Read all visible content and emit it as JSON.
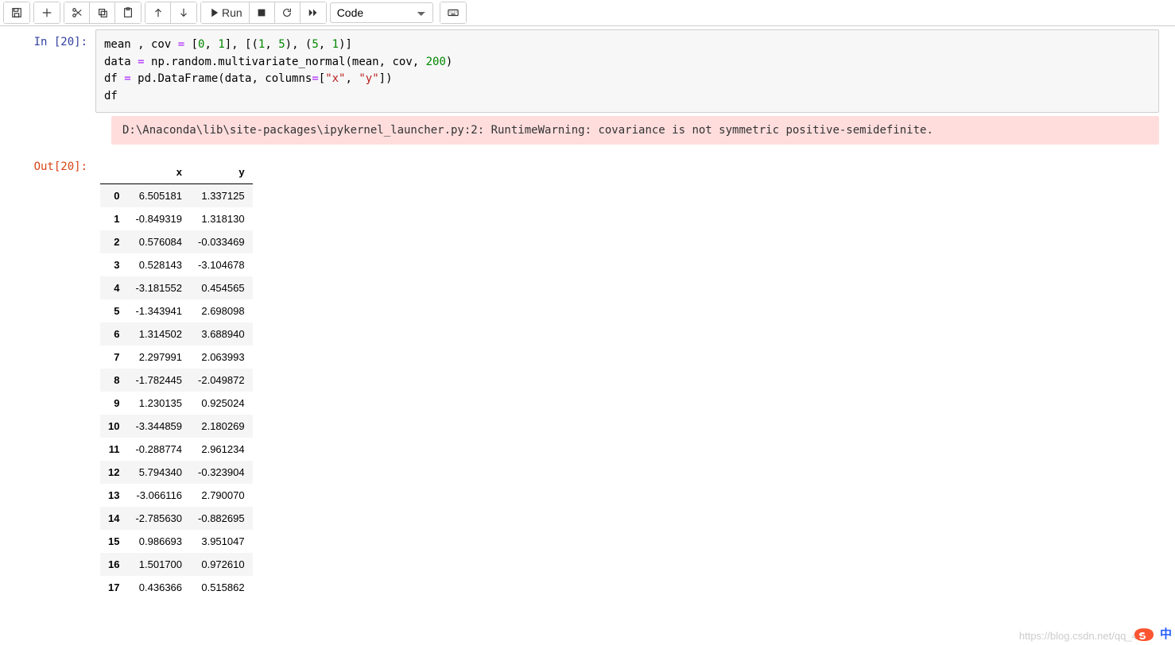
{
  "toolbar": {
    "run_label": "Run",
    "cell_type": "Code"
  },
  "cell": {
    "in_prompt": "In  [20]:",
    "out_prompt": "Out[20]:",
    "code_tokens": [
      [
        "",
        "mean",
        " ",
        ",",
        " ",
        "cov",
        " ",
        "=",
        " ",
        "[",
        "0",
        ",",
        " ",
        "1",
        "]",
        ",",
        " ",
        "[",
        "(",
        "1",
        ",",
        " ",
        "5",
        ")",
        ",",
        " ",
        "(",
        "5",
        ",",
        " ",
        "1",
        ")",
        "]"
      ],
      [
        "",
        "data",
        " ",
        "=",
        " ",
        "np",
        ".",
        "random",
        ".",
        "multivariate_normal",
        "(",
        "mean",
        ",",
        " ",
        "cov",
        ",",
        " ",
        "200",
        ")"
      ],
      [
        "",
        "df",
        " ",
        "=",
        " ",
        "pd",
        ".",
        "DataFrame",
        "(",
        "data",
        ",",
        " ",
        "columns",
        "=",
        "[",
        "\"x\"",
        ",",
        " ",
        "\"y\"",
        "]",
        ")"
      ],
      [
        "",
        "df"
      ]
    ],
    "code_classes": [
      [
        "",
        "",
        "",
        "",
        "",
        "",
        "",
        "op",
        "",
        "",
        "num",
        "",
        "",
        "num",
        "",
        "",
        "",
        "",
        "",
        "num",
        "",
        "",
        "num",
        "",
        "",
        "",
        "",
        "num",
        "",
        "",
        "num",
        "",
        "",
        ""
      ],
      [
        "",
        "",
        "",
        "op",
        "",
        "",
        "",
        "",
        "",
        "",
        "",
        "",
        "",
        "",
        "",
        "",
        "",
        "num",
        ""
      ],
      [
        "",
        "",
        "",
        "op",
        "",
        "",
        "",
        "",
        "",
        "",
        "",
        "",
        "",
        "op",
        "",
        "str",
        "",
        "",
        "str",
        "",
        ""
      ],
      [
        "",
        ""
      ]
    ],
    "warning": "D:\\Anaconda\\lib\\site-packages\\ipykernel_launcher.py:2: RuntimeWarning: covariance is not symmetric positive-semidefinite."
  },
  "df": {
    "columns": [
      "x",
      "y"
    ],
    "rows": [
      {
        "i": "0",
        "x": "6.505181",
        "y": "1.337125"
      },
      {
        "i": "1",
        "x": "-0.849319",
        "y": "1.318130"
      },
      {
        "i": "2",
        "x": "0.576084",
        "y": "-0.033469"
      },
      {
        "i": "3",
        "x": "0.528143",
        "y": "-3.104678"
      },
      {
        "i": "4",
        "x": "-3.181552",
        "y": "0.454565"
      },
      {
        "i": "5",
        "x": "-1.343941",
        "y": "2.698098"
      },
      {
        "i": "6",
        "x": "1.314502",
        "y": "3.688940"
      },
      {
        "i": "7",
        "x": "2.297991",
        "y": "2.063993"
      },
      {
        "i": "8",
        "x": "-1.782445",
        "y": "-2.049872"
      },
      {
        "i": "9",
        "x": "1.230135",
        "y": "0.925024"
      },
      {
        "i": "10",
        "x": "-3.344859",
        "y": "2.180269"
      },
      {
        "i": "11",
        "x": "-0.288774",
        "y": "2.961234"
      },
      {
        "i": "12",
        "x": "5.794340",
        "y": "-0.323904"
      },
      {
        "i": "13",
        "x": "-3.066116",
        "y": "2.790070"
      },
      {
        "i": "14",
        "x": "-2.785630",
        "y": "-0.882695"
      },
      {
        "i": "15",
        "x": "0.986693",
        "y": "3.951047"
      },
      {
        "i": "16",
        "x": "1.501700",
        "y": "0.972610"
      },
      {
        "i": "17",
        "x": "0.436366",
        "y": "0.515862"
      }
    ]
  },
  "watermark": "https://blog.csdn.net/qq_43",
  "lang": "中"
}
